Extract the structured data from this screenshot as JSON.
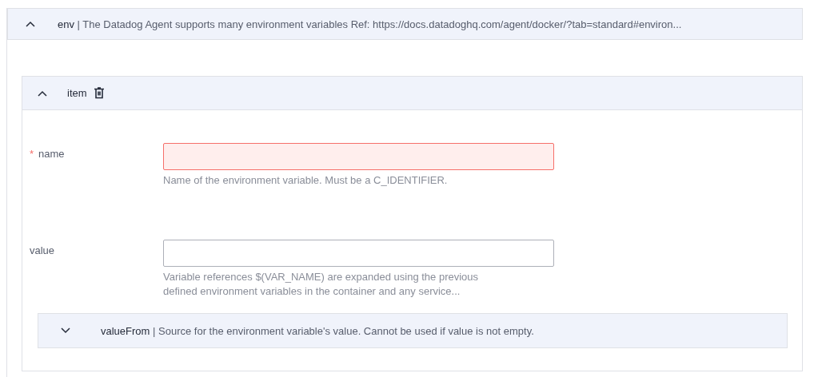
{
  "section": {
    "name": "env",
    "separator": "|",
    "description": "The Datadog Agent supports many environment variables Ref: https://docs.datadoghq.com/agent/docker/?tab=standard#environ...",
    "expanded": true,
    "item": {
      "title": "item",
      "expanded": true,
      "fields": [
        {
          "label": "name",
          "required": true,
          "required_marker": "*",
          "error": true,
          "help": "Name of the environment variable. Must be a C_IDENTIFIER."
        },
        {
          "label": "value",
          "required": false,
          "error": false,
          "help": "Variable references $(VAR_NAME) are expanded using the previous defined environment variables in the container and any service..."
        }
      ],
      "subsection": {
        "name": "valueFrom",
        "separator": "|",
        "description": "Source for the environment variable's value. Cannot be used if value is not empty.",
        "expanded": false
      }
    }
  }
}
